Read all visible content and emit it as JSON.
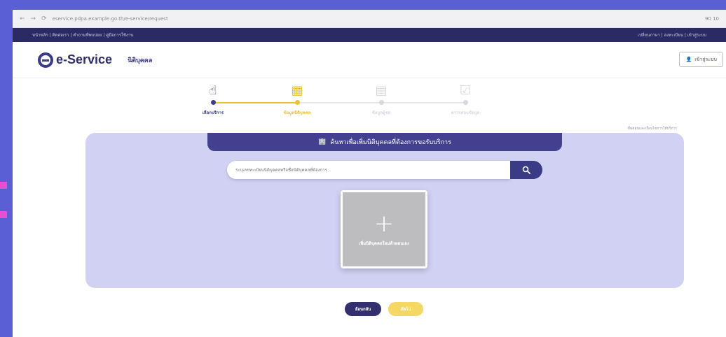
{
  "browser": {
    "url": "eservice.pdpa.example.go.th/e-service/request",
    "right_text": "90   10"
  },
  "top_strip": {
    "left": "หน้าหลัก  |  ติดต่อเรา  |  คำถามที่พบบ่อย  |  คู่มือการใช้งาน",
    "right": "เปลี่ยนภาษา  |  ลงทะเบียน  |  เข้าสู่ระบบ"
  },
  "header": {
    "logo_text": "e-Service",
    "subtitle": "นิติบุคคล",
    "login_label": "เข้าสู่ระบบ"
  },
  "stepper": {
    "steps": [
      {
        "label": "เลือกบริการ",
        "status": "done"
      },
      {
        "label": "ข้อมูลนิติบุคคล",
        "status": "active"
      },
      {
        "label": "ข้อมูลผู้ขอ",
        "status": "pending"
      },
      {
        "label": "ตรวจสอบข้อมูล",
        "status": "pending"
      }
    ],
    "colors": {
      "done": "#3d3d8a",
      "active": "#e9c23a",
      "pending": "#d8d8de"
    }
  },
  "side_link": "ขั้นตอนและเงื่อนไขการให้บริการ",
  "panel": {
    "header_title": "ค้นหาเพื่อเพิ่มนิติบุคคลที่ต้องการขอรับบริการ",
    "search_placeholder": "ระบุเลขทะเบียนนิติบุคคลหรือชื่อนิติบุคคลที่ต้องการ",
    "add_label": "เพิ่มนิติบุคคลใหม่ด้วยตนเอง"
  },
  "buttons": {
    "back": "ย้อนกลับ",
    "next": "ถัดไป"
  },
  "colors": {
    "primary": "#43408f",
    "accent": "#f5d764",
    "panel_bg": "#d0d1f3",
    "page_bg": "#5b5fd6"
  }
}
